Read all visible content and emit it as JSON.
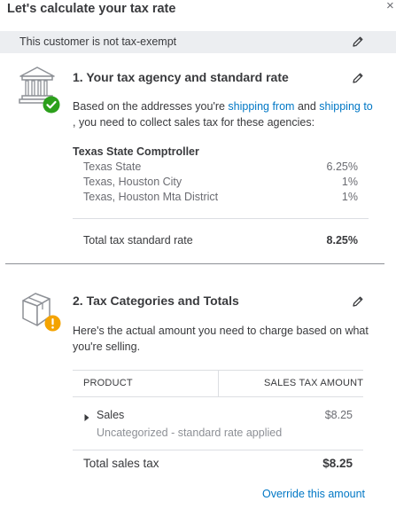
{
  "dialog": {
    "title": "Let's calculate your tax rate",
    "close_glyph": "×"
  },
  "banner": {
    "text": "This customer is not tax-exempt"
  },
  "section1": {
    "title": "1. Your tax agency and standard rate",
    "desc_before": "Based on the addresses you're ",
    "link_from": "shipping from",
    "desc_mid": " and ",
    "link_to": "shipping to",
    "desc_after": ", you need to collect sales tax for these agencies:",
    "agency": "Texas State Comptroller",
    "rates": [
      {
        "name": "Texas State",
        "value": "6.25%"
      },
      {
        "name": "Texas, Houston City",
        "value": "1%"
      },
      {
        "name": "Texas, Houston Mta District",
        "value": "1%"
      }
    ],
    "total_label": "Total tax standard rate",
    "total_value": "8.25%"
  },
  "section2": {
    "title": "2. Tax Categories and Totals",
    "desc": "Here's the actual amount you need to charge based on what you're selling.",
    "col_product": "PRODUCT",
    "col_amount": "SALES TAX AMOUNT",
    "item_name": "Sales",
    "item_amount": "$8.25",
    "item_sub": "Uncategorized - standard rate applied",
    "total_label": "Total sales tax",
    "total_value": "$8.25",
    "override_link": "Override this amount"
  },
  "icons": {
    "edit": "pencil-icon",
    "agency": "bank-icon",
    "check": "checkmark-badge-icon",
    "package": "box-icon",
    "warning": "warning-badge-icon",
    "expand": "caret-right-icon"
  },
  "colors": {
    "link": "#0077c5",
    "success": "#2ca01c",
    "warning": "#f4a300",
    "banner": "#eceef1"
  }
}
